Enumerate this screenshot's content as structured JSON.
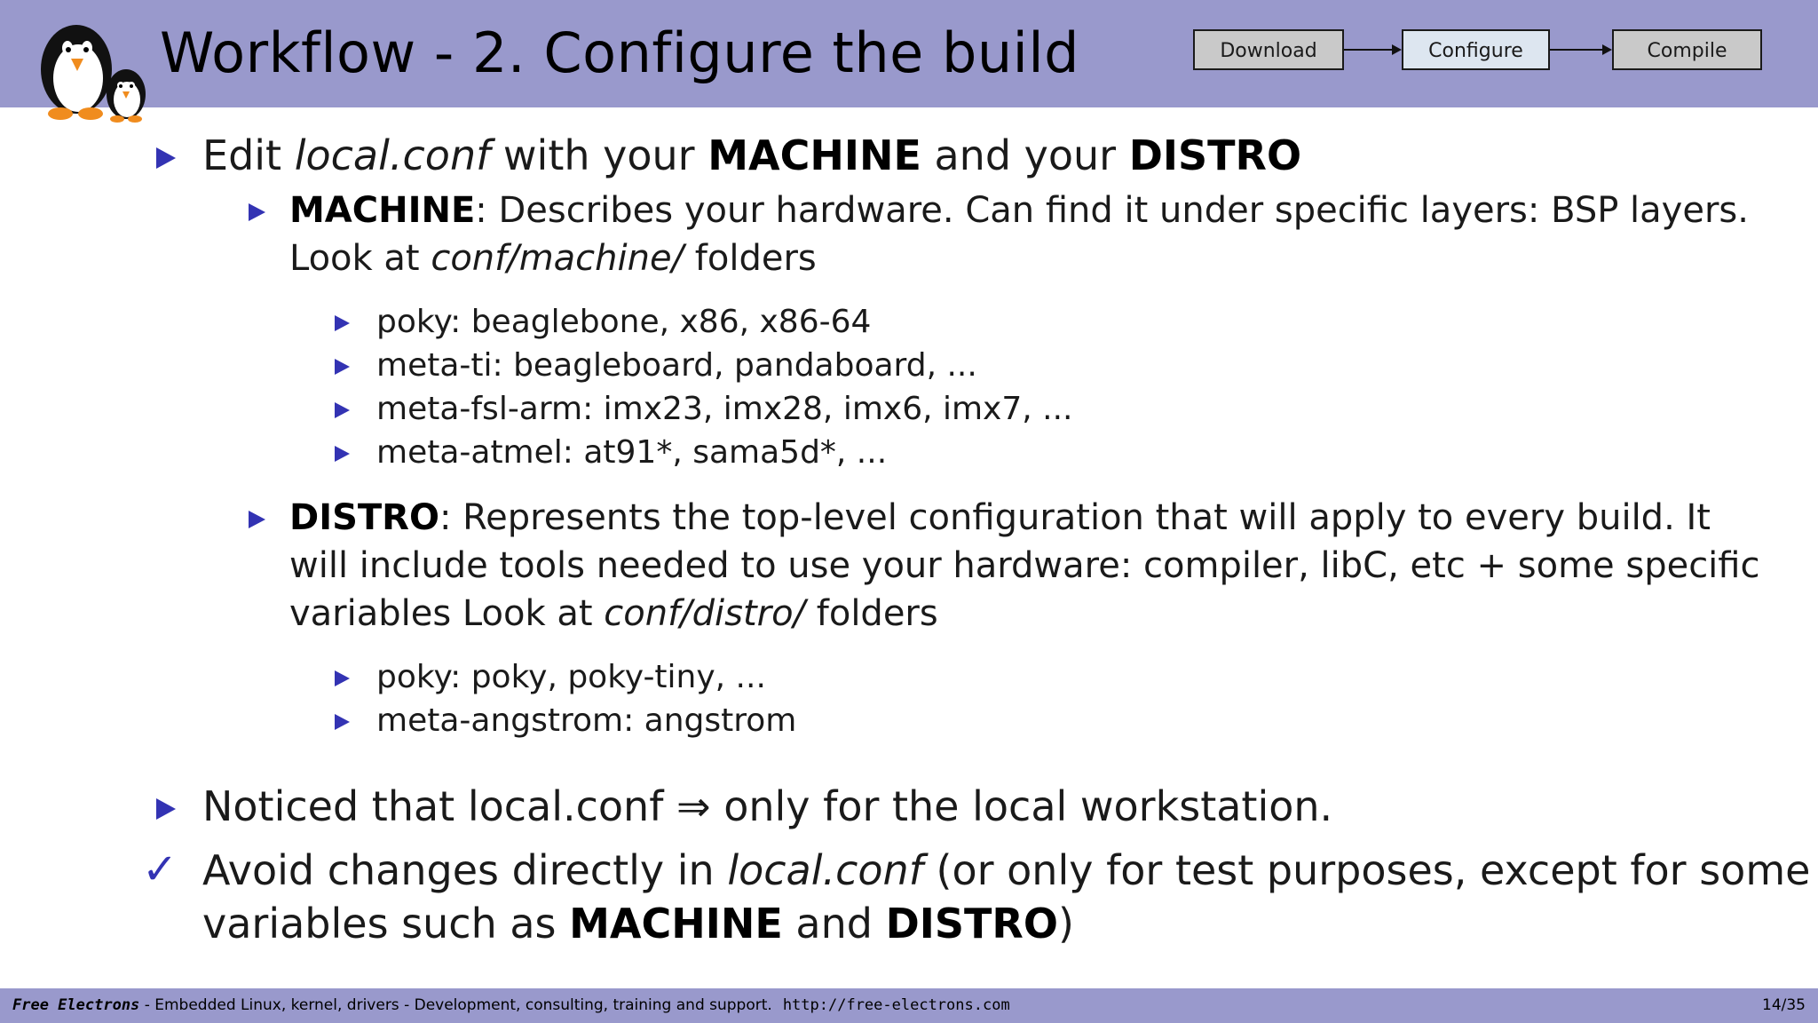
{
  "header": {
    "title": "Workflow - 2.  Configure the build",
    "flow": {
      "download": "Download",
      "configure": "Configure",
      "compile": "Compile"
    }
  },
  "content": {
    "b1": {
      "p1": "Edit ",
      "i1": "local.conf",
      "p2": " with your ",
      "b1": "MACHINE",
      "p3": " and your ",
      "b2": "DISTRO"
    },
    "machine": {
      "label": "MACHINE",
      "line1": ": Describes your hardware.  Can find it under specific layers:  BSP layers.",
      "line2_a": "Look at ",
      "line2_i": "conf/machine/",
      "line2_b": " folders",
      "items": [
        "poky:  beaglebone, x86, x86-64",
        "meta-ti:  beagleboard, pandaboard, ...",
        "meta-fsl-arm:  imx23, imx28, imx6, imx7, ...",
        "meta-atmel:  at91*, sama5d*, ..."
      ]
    },
    "distro": {
      "label": "DISTRO",
      "line1": ": Represents the top-level configuration that will apply to every build.  It",
      "line2": "will include tools needed to use your hardware:  compiler, libC, etc + some specific",
      "line3_a": "variables Look at ",
      "line3_i": "conf/distro/",
      "line3_b": " folders",
      "items": [
        "poky:  poky, poky-tiny, ...",
        "meta-angstrom:  angstrom"
      ]
    },
    "noticed": "Noticed that local.conf ⇒ only for the local workstation.",
    "avoid": {
      "check": "✓",
      "l1_a": "Avoid changes directly in ",
      "l1_i": "local.conf",
      "l1_b": " (or only for test purposes, except for some",
      "l2_a": "variables such as ",
      "l2_b1": "MACHINE",
      "l2_c": " and ",
      "l2_b2": "DISTRO",
      "l2_d": ")"
    }
  },
  "footer": {
    "brand": "Free Electrons",
    "text": " - Embedded Linux, kernel, drivers - Development, consulting, training and support.",
    "url": "http://free-electrons.com",
    "page": "14/35"
  },
  "colors": {
    "header": "#9999cc",
    "bullet": "#3333b3"
  },
  "icons": [
    "penguin-logo-icon",
    "triangle-bullet-icon",
    "check-icon",
    "arrow-icon"
  ]
}
